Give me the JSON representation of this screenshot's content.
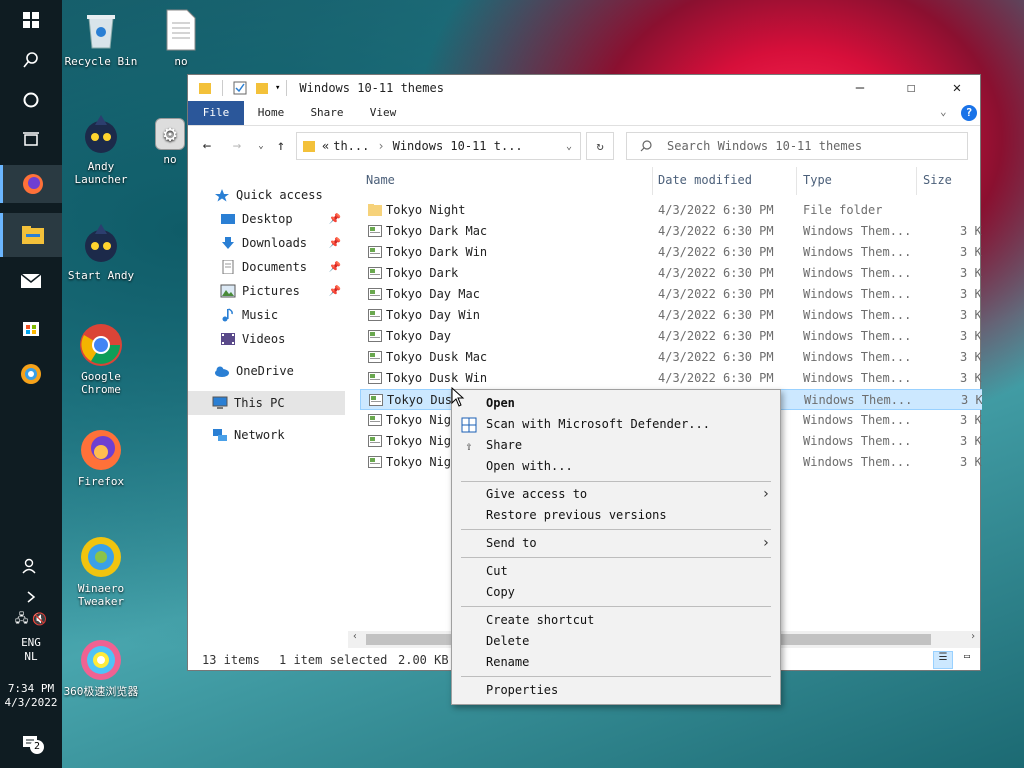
{
  "taskbar": {
    "lang": [
      "ENG",
      "NL"
    ],
    "time": "7:34 PM",
    "date": "4/3/2022",
    "notification_count": "2"
  },
  "desktop": {
    "icons": [
      {
        "label": "Recycle Bin"
      },
      {
        "label": "no"
      },
      {
        "label": "Andy Launcher"
      },
      {
        "label": "no"
      },
      {
        "label": "Start Andy"
      },
      {
        "label": "Google Chrome"
      },
      {
        "label": "Firefox"
      },
      {
        "label": "Winaero Tweaker"
      },
      {
        "label": "360极速浏览器"
      }
    ]
  },
  "window": {
    "title": "Windows 10-11 themes",
    "tabs": [
      "File",
      "Home",
      "Share",
      "View"
    ],
    "address": {
      "prefix": "«",
      "crumbs": [
        "th...",
        "Windows 10-11 t..."
      ]
    },
    "search_placeholder": "Search Windows 10-11 themes",
    "nav": {
      "quick_access": "Quick access",
      "items": [
        "Desktop",
        "Downloads",
        "Documents",
        "Pictures",
        "Music",
        "Videos"
      ],
      "onedrive": "OneDrive",
      "this_pc": "This PC",
      "network": "Network"
    },
    "columns": [
      "Name",
      "Date modified",
      "Type",
      "Size"
    ],
    "files": [
      {
        "name": "Tokyo Night",
        "date": "4/3/2022 6:30 PM",
        "type": "File folder",
        "size": ""
      },
      {
        "name": "Tokyo Dark Mac",
        "date": "4/3/2022 6:30 PM",
        "type": "Windows Them...",
        "size": "3 K"
      },
      {
        "name": "Tokyo Dark Win",
        "date": "4/3/2022 6:30 PM",
        "type": "Windows Them...",
        "size": "3 K"
      },
      {
        "name": "Tokyo Dark",
        "date": "4/3/2022 6:30 PM",
        "type": "Windows Them...",
        "size": "3 K"
      },
      {
        "name": "Tokyo Day Mac",
        "date": "4/3/2022 6:30 PM",
        "type": "Windows Them...",
        "size": "3 K"
      },
      {
        "name": "Tokyo Day Win",
        "date": "4/3/2022 6:30 PM",
        "type": "Windows Them...",
        "size": "3 K"
      },
      {
        "name": "Tokyo Day",
        "date": "4/3/2022 6:30 PM",
        "type": "Windows Them...",
        "size": "3 K"
      },
      {
        "name": "Tokyo Dusk Mac",
        "date": "4/3/2022 6:30 PM",
        "type": "Windows Them...",
        "size": "3 K"
      },
      {
        "name": "Tokyo Dusk Win",
        "date": "4/3/2022 6:30 PM",
        "type": "Windows Them...",
        "size": "3 K"
      },
      {
        "name": "Tokyo Dus",
        "date": "",
        "type": "Windows Them...",
        "size": "3 K"
      },
      {
        "name": "Tokyo Nig",
        "date": "",
        "type": "Windows Them...",
        "size": "3 K"
      },
      {
        "name": "Tokyo Nig",
        "date": "",
        "type": "Windows Them...",
        "size": "3 K"
      },
      {
        "name": "Tokyo Nig",
        "date": "",
        "type": "Windows Them...",
        "size": "3 K"
      }
    ],
    "status": {
      "items": "13 items",
      "selected": "1 item selected",
      "size": "2.00 KB"
    }
  },
  "context_menu": {
    "open": "Open",
    "scan": "Scan with Microsoft Defender...",
    "share": "Share",
    "open_with": "Open with...",
    "give_access": "Give access to",
    "restore": "Restore previous versions",
    "send_to": "Send to",
    "cut": "Cut",
    "copy": "Copy",
    "create_shortcut": "Create shortcut",
    "delete": "Delete",
    "rename": "Rename",
    "properties": "Properties"
  },
  "colors": {
    "accent": "#2b579a",
    "selection": "#cce8ff"
  }
}
